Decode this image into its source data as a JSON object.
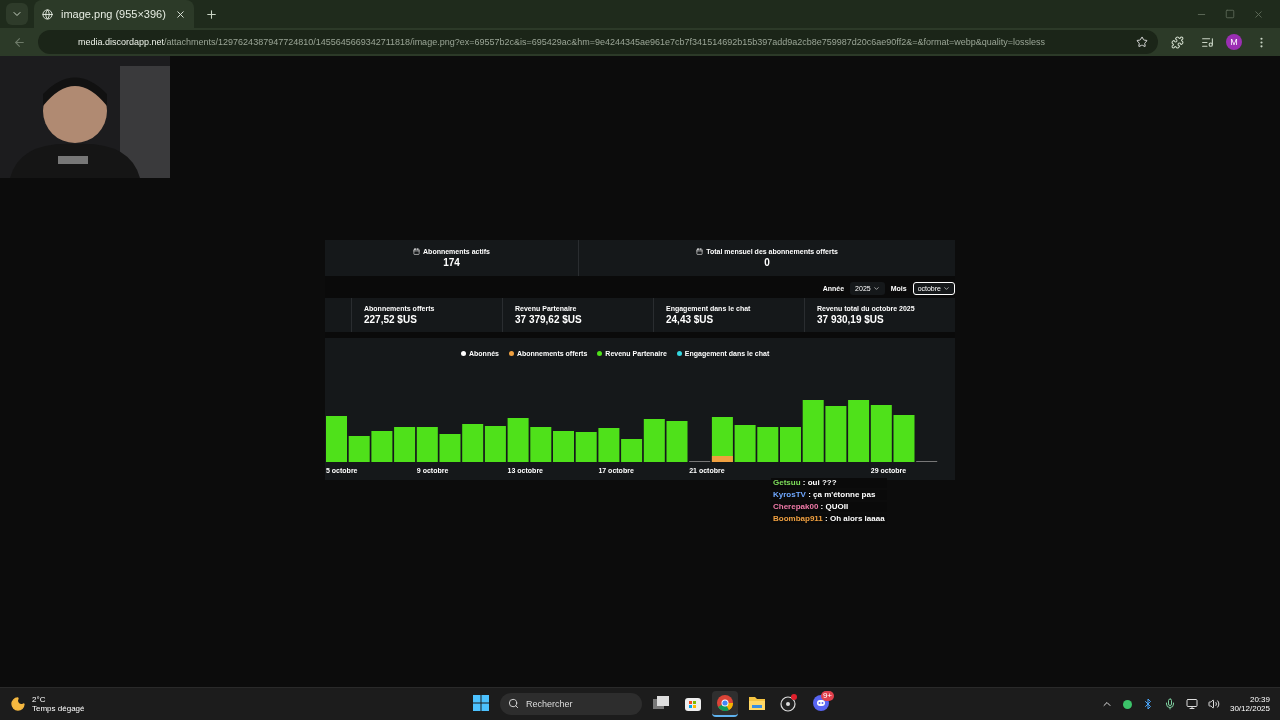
{
  "browser": {
    "tabs": [
      {
        "title": "image.png (955×396)",
        "selected": true
      }
    ],
    "url_host": "media.discordapp.net",
    "url_path": "/attachments/1297624387947724810/1455645669342711818/image.png?ex=69557b2c&is=695429ac&hm=9e4244345ae961e7cb7f341514692b15b397add9a2cb8e759987d20c6ae90ff2&=&format=webp&quality=lossless",
    "profile_initial": "M"
  },
  "image": {
    "top_stats": [
      {
        "label": "Abonnements actifs",
        "value": "174"
      },
      {
        "label": "Total mensuel des abonnements offerts",
        "value": "0"
      }
    ],
    "filters": [
      {
        "label": "Année",
        "value": "2025",
        "focused": false
      },
      {
        "label": "Mois",
        "value": "octobre",
        "focused": true
      }
    ],
    "revenue_stats": [
      {
        "label": "Abonnements offerts",
        "value": "227,52 $US"
      },
      {
        "label": "Revenu Partenaire",
        "value": "37 379,62 $US"
      },
      {
        "label": "Engagement dans le chat",
        "value": "24,43 $US"
      },
      {
        "label": "Revenu total du octobre 2025",
        "value": "37 930,19 $US"
      }
    ],
    "legend": [
      {
        "label": "Abonnés",
        "color": "#ffffff"
      },
      {
        "label": "Abonnements offerts",
        "color": "#f0a040"
      },
      {
        "label": "Revenu Partenaire",
        "color": "#4fe11a"
      },
      {
        "label": "Engagement dans le chat",
        "color": "#33d6e0"
      }
    ],
    "x_labels": [
      "5 octobre",
      "9 octobre",
      "13 octobre",
      "17 octobre",
      "21 octobre",
      "29 octobre"
    ]
  },
  "chat": [
    {
      "user": "Getsuu",
      "message": " : oui ???",
      "color": "#7ddc5a"
    },
    {
      "user": "KyrosTV",
      "message": " : ça m'étonne pas",
      "color": "#6fa8ff"
    },
    {
      "user": "Cherepak00",
      "message": " : QUOII",
      "color": "#f07aa8"
    },
    {
      "user": "Boombap911",
      "message": " : Oh alors laaaa",
      "color": "#f0a040"
    }
  ],
  "taskbar": {
    "weather": {
      "temp": "2°C",
      "condition": "Temps dégagé"
    },
    "search": {
      "placeholder": "Rechercher"
    },
    "apps": [
      {
        "kind": "windows",
        "active": false
      },
      {
        "kind": "tasks",
        "active": false
      },
      {
        "kind": "store",
        "active": false
      },
      {
        "kind": "chrome",
        "active": true
      },
      {
        "kind": "folder",
        "active": false
      },
      {
        "kind": "obs",
        "active": false
      },
      {
        "kind": "discord",
        "active": false
      }
    ],
    "discord_badge": "9+",
    "time": "20:39",
    "date": "30/12/2025"
  }
}
